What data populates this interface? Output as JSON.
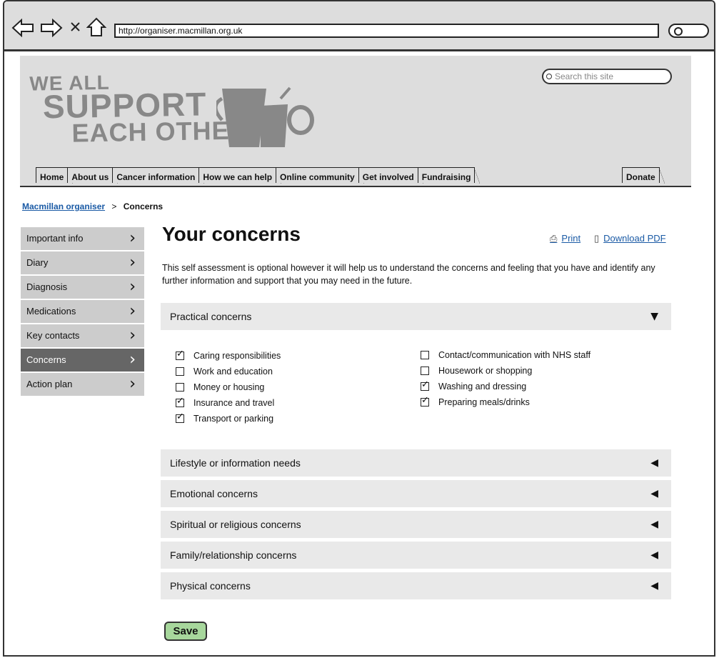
{
  "browser": {
    "url": "http://organiser.macmillan.org.uk",
    "icons": [
      "back-arrow-icon",
      "forward-arrow-icon",
      "close-icon",
      "home-icon",
      "search-icon"
    ]
  },
  "header": {
    "logo_lines": [
      "WE ALL",
      "SUPPORT",
      "EACH OTHER"
    ],
    "search_placeholder": "Search this site",
    "nav": [
      "Home",
      "About us",
      "Cancer information",
      "How we can help",
      "Online community",
      "Get involved",
      "Fundraising"
    ],
    "donate": "Donate"
  },
  "breadcrumb": {
    "link": "Macmillan organiser",
    "separator": ">",
    "current": "Concerns"
  },
  "sidebar": {
    "items": [
      {
        "label": "Important info",
        "active": false
      },
      {
        "label": "Diary",
        "active": false
      },
      {
        "label": "Diagnosis",
        "active": false
      },
      {
        "label": "Medications",
        "active": false
      },
      {
        "label": "Key contacts",
        "active": false
      },
      {
        "label": "Concerns",
        "active": true
      },
      {
        "label": "Action plan",
        "active": false
      }
    ]
  },
  "main": {
    "title": "Your concerns",
    "print": "Print",
    "download": "Download PDF",
    "intro": "This self assessment is optional however it will help us to understand the concerns and feeling that you have and identify any further information and support that you may need in the future.",
    "sections": [
      {
        "label": "Practical concerns",
        "expanded": true
      },
      {
        "label": "Lifestyle or information needs",
        "expanded": false
      },
      {
        "label": "Emotional concerns",
        "expanded": false
      },
      {
        "label": "Spiritual or religious concerns",
        "expanded": false
      },
      {
        "label": "Family/relationship concerns",
        "expanded": false
      },
      {
        "label": "Physical concerns",
        "expanded": false
      }
    ],
    "practical_left": [
      {
        "label": "Caring responsibilities",
        "checked": true
      },
      {
        "label": "Work and education",
        "checked": false
      },
      {
        "label": "Money or housing",
        "checked": false
      },
      {
        "label": "Insurance and travel",
        "checked": true
      },
      {
        "label": "Transport or parking",
        "checked": true
      }
    ],
    "practical_right": [
      {
        "label": "Contact/communication with NHS staff",
        "checked": false
      },
      {
        "label": "Housework or shopping",
        "checked": false
      },
      {
        "label": "Washing and dressing",
        "checked": true
      },
      {
        "label": "Preparing meals/drinks",
        "checked": true
      }
    ],
    "save": "Save"
  },
  "colors": {
    "link": "#1a5aa5",
    "active_nav": "#666666",
    "save_button": "#a7d79c",
    "logo": "#888888"
  }
}
